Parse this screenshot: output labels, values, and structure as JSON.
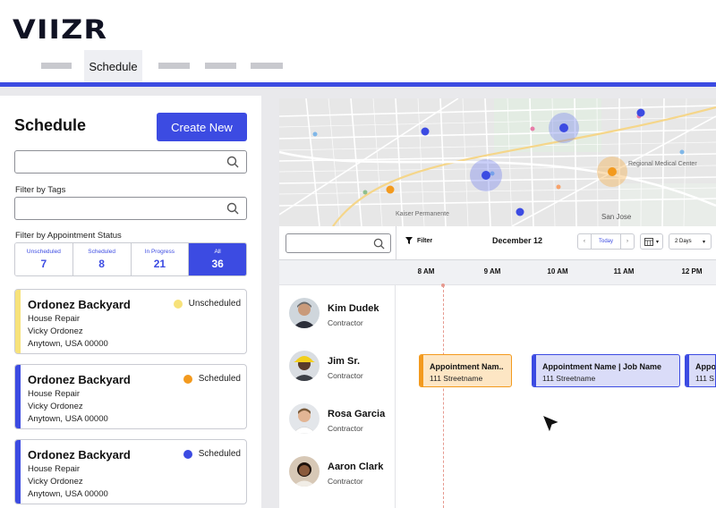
{
  "brand": {
    "logo": "VIIZR"
  },
  "nav": {
    "active_tab": "Schedule"
  },
  "sidebar": {
    "title": "Schedule",
    "create_button": "Create New",
    "filter_tags_label": "Filter by Tags",
    "filter_status_label": "Filter by Appointment Status",
    "statuses": [
      {
        "label": "Unscheduled",
        "count": "7"
      },
      {
        "label": "Scheduled",
        "count": "8"
      },
      {
        "label": "In Progress",
        "count": "21"
      },
      {
        "label": "All",
        "count": "36"
      }
    ],
    "cards": [
      {
        "title": "Ordonez Backyard",
        "service": "House Repair",
        "customer": "Vicky Ordonez",
        "address": "Anytown, USA 00000",
        "status": "Unscheduled",
        "status_color": "#f7e27a",
        "stripe_color": "#f7e27a"
      },
      {
        "title": "Ordonez Backyard",
        "service": "House Repair",
        "customer": "Vicky Ordonez",
        "address": "Anytown, USA 00000",
        "status": "Scheduled",
        "status_color": "#f39a1e",
        "stripe_color": "#3c4be2"
      },
      {
        "title": "Ordonez Backyard",
        "service": "House Repair",
        "customer": "Vicky Ordonez",
        "address": "Anytown, USA 00000",
        "status": "Scheduled",
        "status_color": "#3c4be2",
        "stripe_color": "#3c4be2"
      }
    ]
  },
  "map": {
    "labels": [
      "San Jose",
      "Regional Medical Center",
      "Kaiser Permanente"
    ]
  },
  "scheduler": {
    "filter_label": "Filter",
    "date": "December 12",
    "today_label": "Today",
    "prev_label": "‹",
    "next_label": "›",
    "days_label": "2 Days",
    "times": [
      "8 AM",
      "9 AM",
      "10 AM",
      "11 AM",
      "12 PM"
    ],
    "resources": [
      {
        "name": "Kim Dudek",
        "role": "Contractor"
      },
      {
        "name": "Jim Sr.",
        "role": "Contractor"
      },
      {
        "name": "Rosa Garcia",
        "role": "Contractor"
      },
      {
        "name": "Aaron Clark",
        "role": "Contractor"
      }
    ],
    "appointments": [
      {
        "title": "Appointment Nam..",
        "address": "111 Streetname",
        "bg": "#fde6c4",
        "border": "#f39a1e"
      },
      {
        "title": "Appointment Name | Job Name",
        "address": "111 Streetname",
        "bg": "#dadcf8",
        "border": "#3c4be2"
      },
      {
        "title": "Appo",
        "address": "111 S",
        "bg": "#dadcf8",
        "border": "#3c4be2"
      }
    ]
  },
  "colors": {
    "accent": "#3c4be2",
    "unscheduled": "#f7e27a",
    "scheduled_orange": "#f39a1e"
  }
}
